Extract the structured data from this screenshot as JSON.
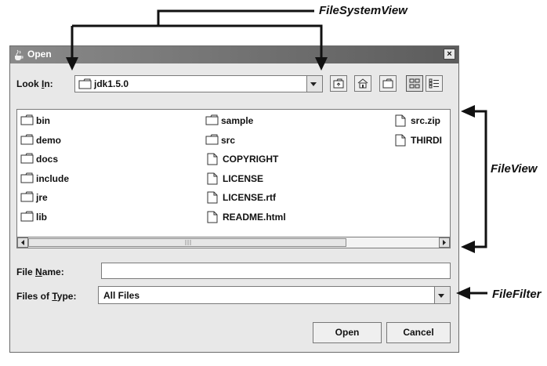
{
  "callouts": {
    "file_system_view": "FileSystemView",
    "file_view": "FileView",
    "file_filter": "FileFilter"
  },
  "dialog": {
    "title": "Open",
    "close_glyph": "×",
    "look_in": {
      "label_pre": "Look ",
      "label_mnemonic": "I",
      "label_post": "n:",
      "value": "jdk1.5.0"
    },
    "toolbar": [
      "up-one-level-icon",
      "home-icon",
      "new-folder-icon",
      "list-view-icon",
      "details-view-icon"
    ],
    "files": {
      "col1": [
        "bin",
        "demo",
        "docs",
        "include",
        "jre",
        "lib"
      ],
      "col2_folders": [
        "sample",
        "src"
      ],
      "col2_files": [
        "COPYRIGHT",
        "LICENSE",
        "LICENSE.rtf",
        "README.html"
      ],
      "col3_files": [
        "src.zip",
        "THIRDI"
      ]
    },
    "file_name": {
      "label_pre": "File ",
      "label_mnemonic": "N",
      "label_post": "ame:",
      "value": ""
    },
    "files_of_type": {
      "label_pre": "Files of ",
      "label_mnemonic": "T",
      "label_post": "ype:",
      "value": "All Files"
    },
    "buttons": {
      "open": "Open",
      "cancel": "Cancel"
    }
  },
  "colors": {
    "title_bar": "#5c5c5c",
    "dialog_bg": "#e8e8e8",
    "arrow": "#111111"
  }
}
